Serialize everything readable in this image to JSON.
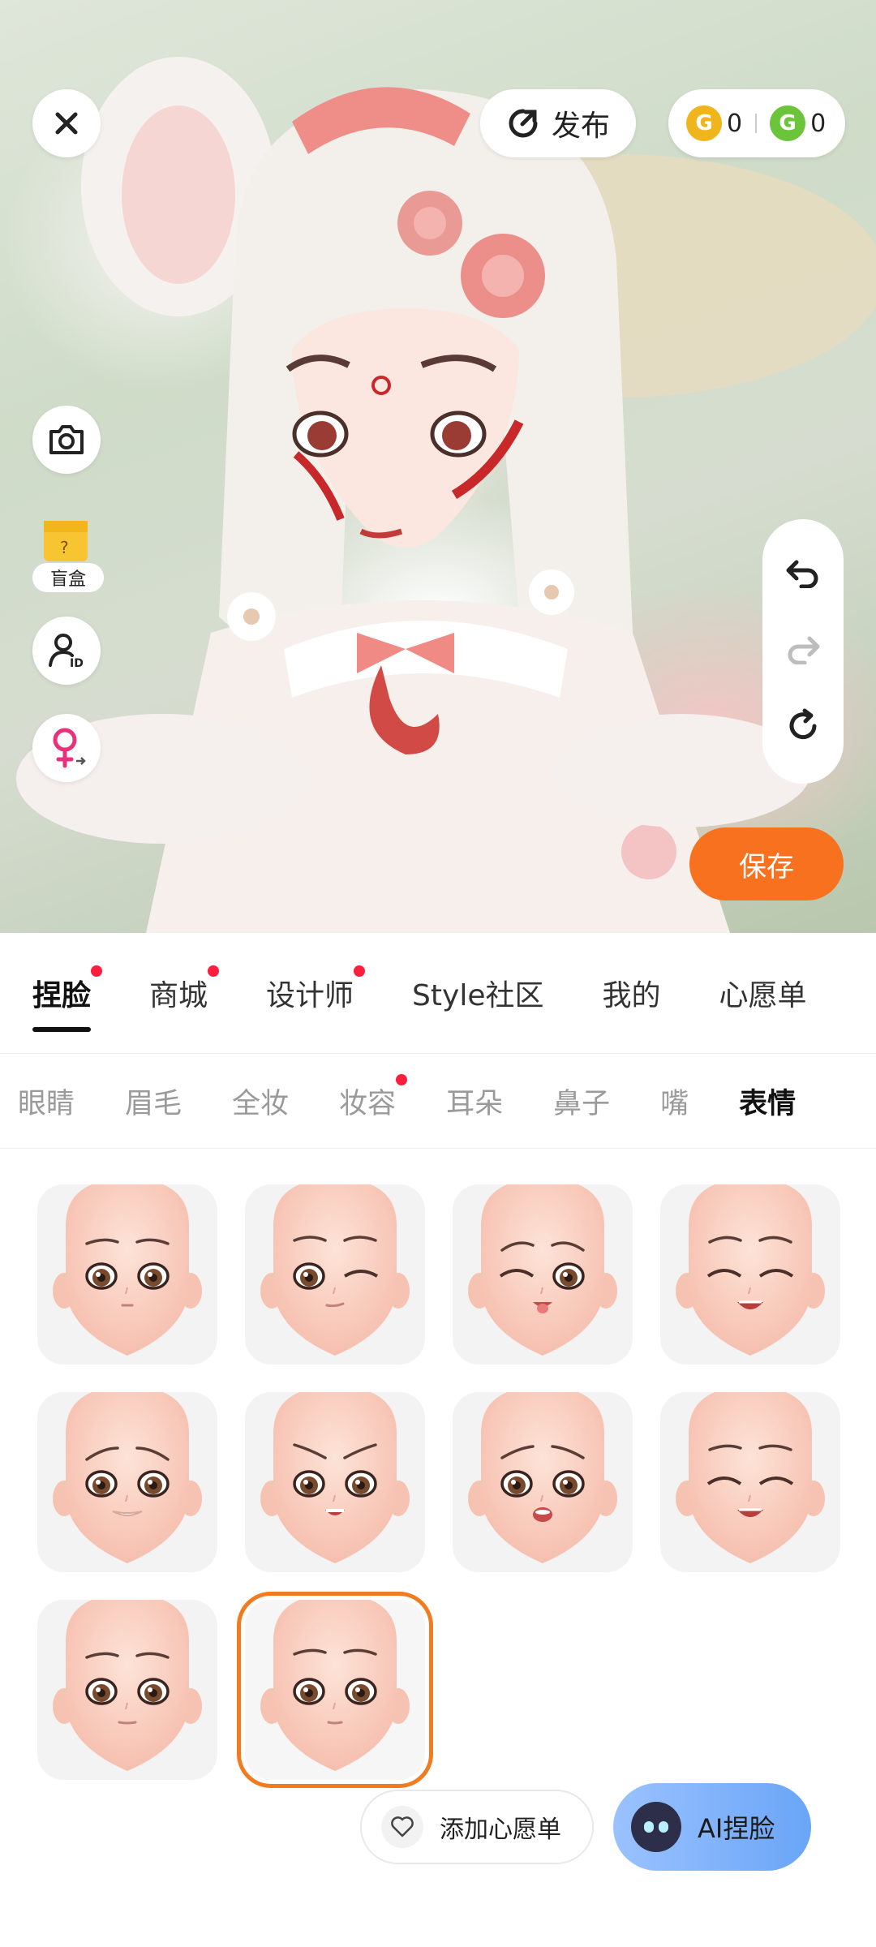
{
  "top": {
    "publish_label": "发布",
    "gold_coins": "0",
    "green_coins": "0"
  },
  "left_tools": {
    "blind_box_label": "盲盒"
  },
  "save_label": "保存",
  "tabs": [
    {
      "label": "捏脸",
      "active": true,
      "dot": true
    },
    {
      "label": "商城",
      "active": false,
      "dot": true
    },
    {
      "label": "设计师",
      "active": false,
      "dot": true
    },
    {
      "label": "Style社区",
      "active": false,
      "dot": false
    },
    {
      "label": "我的",
      "active": false,
      "dot": false
    },
    {
      "label": "心愿单",
      "active": false,
      "dot": false
    }
  ],
  "subtabs": [
    {
      "label": "眼睛",
      "active": false
    },
    {
      "label": "眉毛",
      "active": false
    },
    {
      "label": "全妆",
      "active": false
    },
    {
      "label": "妆容",
      "active": false,
      "dot": true
    },
    {
      "label": "耳朵",
      "active": false
    },
    {
      "label": "鼻子",
      "active": false
    },
    {
      "label": "嘴",
      "active": false
    },
    {
      "label": "表情",
      "active": true
    }
  ],
  "expressions": [
    {
      "name": "neutral-smile"
    },
    {
      "name": "wink"
    },
    {
      "name": "tongue-out"
    },
    {
      "name": "laughing"
    },
    {
      "name": "worried-grin"
    },
    {
      "name": "angry"
    },
    {
      "name": "sad"
    },
    {
      "name": "content"
    },
    {
      "name": "calm"
    },
    {
      "name": "default",
      "selected": true
    }
  ],
  "bottom": {
    "wishlist_label": "添加心愿单",
    "ai_label": "AI捏脸"
  },
  "colors": {
    "accent_orange": "#f7711f",
    "selected_border": "#f27a1f",
    "notify_dot": "#ff1e3c"
  }
}
